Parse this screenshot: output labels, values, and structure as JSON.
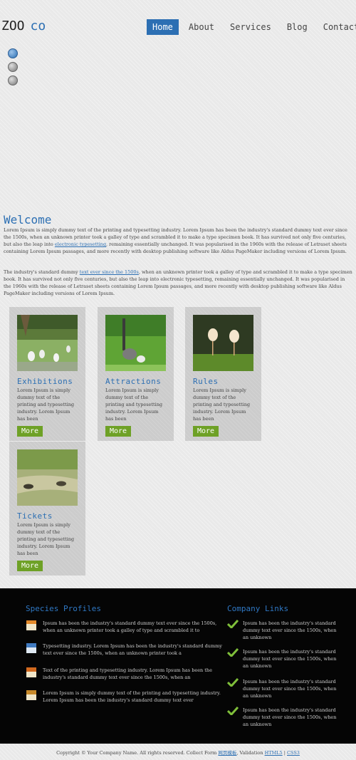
{
  "header": {
    "logo_main": "ZOO",
    "logo_sub": "co",
    "nav": [
      {
        "label": "Home",
        "active": true
      },
      {
        "label": "About",
        "active": false
      },
      {
        "label": "Services",
        "active": false
      },
      {
        "label": "Blog",
        "active": false
      },
      {
        "label": "Contact",
        "active": false
      }
    ]
  },
  "slider": {
    "dots": 3,
    "active_index": 0
  },
  "welcome": {
    "title": "Welcome",
    "p1_start": "Lorem Ipsum is simply dummy text of the printing and typesetting industry. Lorem Ipsum has been the industry's standard dummy text ever since the 1500s, when an unknown printer took a galley of type and scrambled it to make a type specimen book. It has survived not only five centuries, but also the leap into ",
    "p1_link": "electronic typesetting",
    "p1_end": ", remaining essentially unchanged. It was popularised in the 1960s with the release of Letraset sheets containing Lorem Ipsum passages, and more recently with desktop publishing software like Aldus PageMaker including versions of Lorem Ipsum.",
    "p2_start": "The industry's standard dummy ",
    "p2_link": "text ever since the 1500s",
    "p2_end": ", when an unknown printer took a galley of type and scrambled it to make a type specimen book. It has survived not only five centuries, but also the leap into electronic typesetting, remaining essentially unchanged. It was popularised in the 1960s with the release of Letraset sheets containing Lorem Ipsum passages, and more recently with desktop publishing software like Aldus PageMaker including versions of Lorem Ipsum."
  },
  "cards": [
    {
      "title": "Exhibitions",
      "text": "Lorem Ipsum is simply dummy text of the printing and typesetting industry. Lorem Ipsum has been",
      "button": "More"
    },
    {
      "title": "Attractions",
      "text": "Lorem Ipsum is simply dummy text of the printing and typesetting industry. Lorem Ipsum has been",
      "button": "More"
    },
    {
      "title": "Rules",
      "text": "Lorem Ipsum is simply dummy text of the printing and typesetting industry. Lorem Ipsum has been",
      "button": "More"
    },
    {
      "title": "Tickets",
      "text": "Lorem Ipsum is simply dummy text of the printing and typesetting industry. Lorem Ipsum has been",
      "button": "More"
    }
  ],
  "footer": {
    "species_title": "Species Profiles",
    "species": [
      {
        "icon": "document-icon",
        "text": "Ipsum has been the industry's standard dummy text ever since the 1500s, when an unknown printer took a galley of type and scrambled it to"
      },
      {
        "icon": "css-file-icon",
        "text": "Typesetting industry. Lorem Ipsum has been the industry's standard dummy text ever since the 1500s, when an unknown printer took a"
      },
      {
        "icon": "html-file-icon",
        "text": "Text of the printing and typesetting industry. Lorem Ipsum has been the industry's standard dummy text ever since the 1500s, when an"
      },
      {
        "icon": "php-file-icon",
        "text": "Lorem Ipsum is simply dummy text of the printing and typesetting industry. Lorem Ipsum has been the industry's standard dummy text ever"
      }
    ],
    "links_title": "Company Links",
    "links": [
      "Ipsum has been the industry's standard dummy text ever since the 1500s, when an unknown",
      "Ipsum has been the industry's standard dummy text ever since the 1500s, when an unknown",
      "Ipsum has been the industry's standard dummy text ever since the 1500s, when an unknown",
      "Ipsum has been the industry's standard dummy text ever since the 1500s, when an unknown"
    ]
  },
  "copyright": {
    "text": "Copyright © Your Company Name. All rights reserved. Collect Form ",
    "link1": "网页模板",
    "middle": ", Validation ",
    "link2": "HTML5",
    "sep": " | ",
    "link3": "CSS3"
  },
  "colors": {
    "accent": "#2c6fb3",
    "button": "#6ea126",
    "footer_bg": "#050505"
  }
}
